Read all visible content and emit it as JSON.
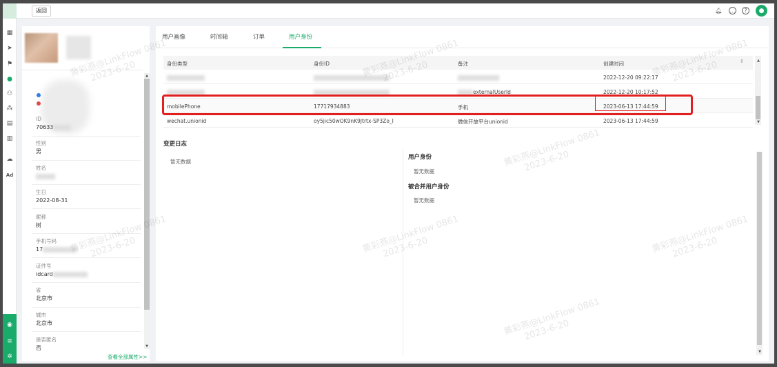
{
  "topbar": {
    "back_label": "返回"
  },
  "profile": {
    "fields": [
      {
        "label": "ID",
        "value": "70633"
      },
      {
        "label": "性别",
        "value": "男"
      },
      {
        "label": "姓名",
        "value": ""
      },
      {
        "label": "生日",
        "value": "2022-08-31"
      },
      {
        "label": "昵称",
        "value": "树"
      },
      {
        "label": "手机号码",
        "value": "17"
      },
      {
        "label": "证件号",
        "value": "idcard"
      },
      {
        "label": "省",
        "value": "北京市"
      },
      {
        "label": "城市",
        "value": "北京市"
      },
      {
        "label": "是否匿名",
        "value": "否"
      }
    ],
    "see_all": "查看全部属性>>"
  },
  "tabs": [
    {
      "label": "用户画像",
      "active": false
    },
    {
      "label": "时间轴",
      "active": false
    },
    {
      "label": "订单",
      "active": false
    },
    {
      "label": "用户身份",
      "active": true
    }
  ],
  "identity_table": {
    "headers": [
      "身份类型",
      "身份ID",
      "备注",
      "创建时间"
    ],
    "rows": [
      {
        "type": "",
        "id": "",
        "note": "",
        "created": "2022-12-20 09:22:17"
      },
      {
        "type": "",
        "id": "",
        "note": "externalUserId",
        "created": "2022-12-20 10:17:52"
      },
      {
        "type": "mobilePhone",
        "id": "17717934883",
        "note": "手机",
        "created": "2023-06-13 17:44:59"
      },
      {
        "type": "wechat.unionid",
        "id": "oy5jic50wOK9nK9Jtrtx-SP3Zo_I",
        "note": "微信开放平台unionid",
        "created": "2023-06-13 17:44:59"
      }
    ]
  },
  "change_log": {
    "title": "变更日志",
    "empty": "暂无数据"
  },
  "user_identity": {
    "title": "用户身份",
    "empty": "暂无数据"
  },
  "merged_identity": {
    "title": "被合并用户身份",
    "empty": "暂无数据"
  },
  "watermark": {
    "name": "黄彩燕@LinkFlow 0861",
    "date": "2023-6-20"
  },
  "colors": {
    "accent": "#1aaa6a",
    "highlight": "#e31e1e"
  }
}
